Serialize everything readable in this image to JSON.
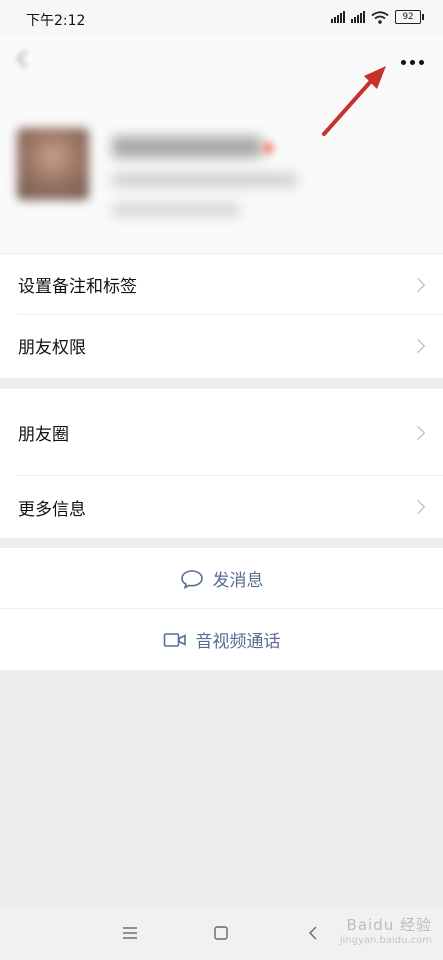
{
  "status_bar": {
    "time": "下午2:12",
    "battery": "92",
    "icons": [
      "signal-icon",
      "hd-signal-icon",
      "wifi-icon",
      "battery-icon"
    ]
  },
  "header": {
    "more_icon": "more-dots-icon",
    "back_icon": "back-arrow-icon"
  },
  "menu_group_1": [
    {
      "label": "设置备注和标签"
    },
    {
      "label": "朋友权限"
    }
  ],
  "menu_group_2": [
    {
      "label": "朋友圈"
    },
    {
      "label": "更多信息"
    }
  ],
  "actions": {
    "message_label": "发消息",
    "message_icon": "chat-bubble-icon",
    "call_label": "音视频通话",
    "call_icon": "video-camera-icon"
  },
  "nav": {
    "icons": [
      "menu-icon",
      "home-square-icon",
      "back-chevron-icon"
    ]
  },
  "watermark": {
    "main": "Baidu 经验",
    "sub": "jingyan.baidu.com"
  },
  "colors": {
    "link": "#576b95",
    "annotation_arrow": "#c8302c",
    "background": "#ededed"
  }
}
